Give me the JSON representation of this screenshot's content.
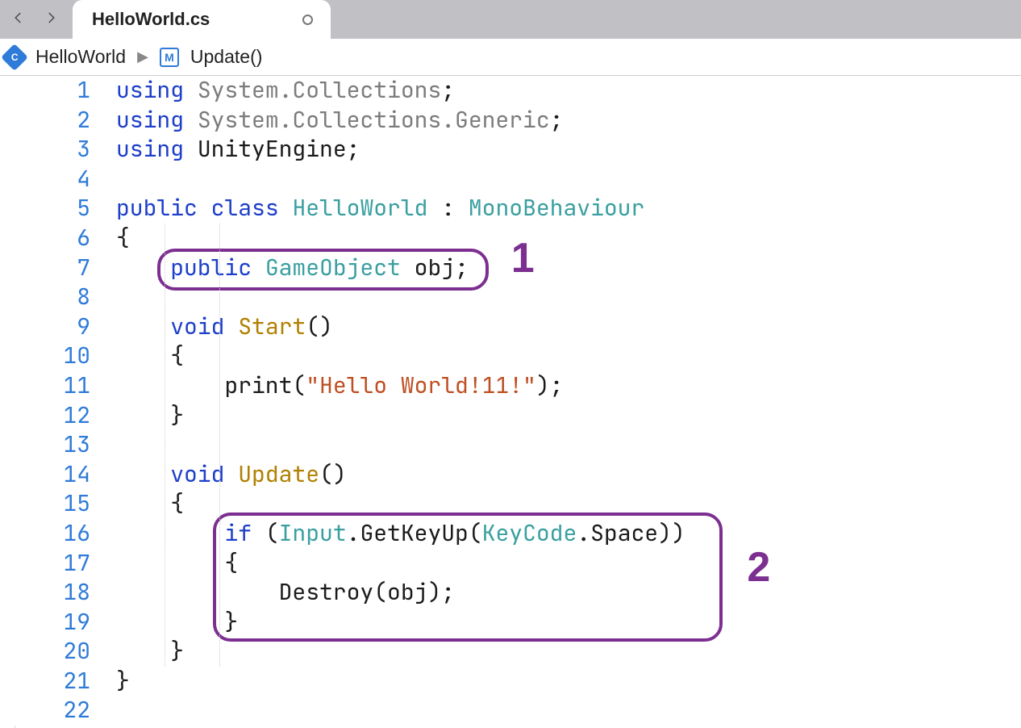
{
  "tab": {
    "title": "HelloWorld.cs"
  },
  "breadcrumb": {
    "class": "HelloWorld",
    "method": "Update()"
  },
  "colors": {
    "annotation": "#7c2f91",
    "keyword": "#1e3fc9",
    "type": "#3a9fa0",
    "string": "#bf4f22",
    "lineNumber": "#2f7bd9"
  },
  "annotations": [
    {
      "id": 1,
      "label": "1",
      "target_lines": [
        7
      ]
    },
    {
      "id": 2,
      "label": "2",
      "target_lines": [
        16,
        17,
        18,
        19
      ]
    }
  ],
  "code": [
    {
      "n": 1,
      "indent": 0,
      "tokens": [
        [
          "kw",
          "using"
        ],
        [
          "punct",
          " "
        ],
        [
          "ns",
          "System.Collections"
        ],
        [
          "punct",
          ";"
        ]
      ]
    },
    {
      "n": 2,
      "indent": 0,
      "tokens": [
        [
          "kw",
          "using"
        ],
        [
          "punct",
          " "
        ],
        [
          "ns",
          "System.Collections.Generic"
        ],
        [
          "punct",
          ";"
        ]
      ]
    },
    {
      "n": 3,
      "indent": 0,
      "tokens": [
        [
          "kw",
          "using"
        ],
        [
          "punct",
          " "
        ],
        [
          "ident",
          "UnityEngine"
        ],
        [
          "punct",
          ";"
        ]
      ]
    },
    {
      "n": 4,
      "indent": 0,
      "tokens": []
    },
    {
      "n": 5,
      "indent": 0,
      "tokens": [
        [
          "kw",
          "public"
        ],
        [
          "punct",
          " "
        ],
        [
          "kw",
          "class"
        ],
        [
          "punct",
          " "
        ],
        [
          "classname",
          "HelloWorld"
        ],
        [
          "punct",
          " : "
        ],
        [
          "type",
          "MonoBehaviour"
        ]
      ]
    },
    {
      "n": 6,
      "indent": 0,
      "tokens": [
        [
          "punct",
          "{"
        ]
      ]
    },
    {
      "n": 7,
      "indent": 1,
      "tokens": [
        [
          "kw",
          "public"
        ],
        [
          "punct",
          " "
        ],
        [
          "type",
          "GameObject"
        ],
        [
          "punct",
          " "
        ],
        [
          "ident",
          "obj"
        ],
        [
          "punct",
          ";"
        ]
      ]
    },
    {
      "n": 8,
      "indent": 1,
      "tokens": []
    },
    {
      "n": 9,
      "indent": 1,
      "tokens": [
        [
          "kw",
          "void"
        ],
        [
          "punct",
          " "
        ],
        [
          "method",
          "Start"
        ],
        [
          "punct",
          "()"
        ]
      ]
    },
    {
      "n": 10,
      "indent": 1,
      "tokens": [
        [
          "punct",
          "{"
        ]
      ]
    },
    {
      "n": 11,
      "indent": 2,
      "tokens": [
        [
          "ident",
          "print"
        ],
        [
          "punct",
          "("
        ],
        [
          "str",
          "\"Hello World!11!\""
        ],
        [
          "punct",
          ");"
        ]
      ]
    },
    {
      "n": 12,
      "indent": 1,
      "tokens": [
        [
          "punct",
          "}"
        ]
      ]
    },
    {
      "n": 13,
      "indent": 1,
      "tokens": []
    },
    {
      "n": 14,
      "indent": 1,
      "tokens": [
        [
          "kw",
          "void"
        ],
        [
          "punct",
          " "
        ],
        [
          "method",
          "Update"
        ],
        [
          "punct",
          "()"
        ]
      ]
    },
    {
      "n": 15,
      "indent": 1,
      "tokens": [
        [
          "punct",
          "{"
        ]
      ]
    },
    {
      "n": 16,
      "indent": 2,
      "tokens": [
        [
          "kw",
          "if"
        ],
        [
          "punct",
          " ("
        ],
        [
          "type",
          "Input"
        ],
        [
          "punct",
          "."
        ],
        [
          "ident",
          "GetKeyUp"
        ],
        [
          "punct",
          "("
        ],
        [
          "type",
          "KeyCode"
        ],
        [
          "punct",
          "."
        ],
        [
          "ident",
          "Space"
        ],
        [
          "punct",
          "))"
        ]
      ]
    },
    {
      "n": 17,
      "indent": 2,
      "tokens": [
        [
          "punct",
          "{"
        ]
      ]
    },
    {
      "n": 18,
      "indent": 3,
      "tokens": [
        [
          "ident",
          "Destroy"
        ],
        [
          "punct",
          "("
        ],
        [
          "ident",
          "obj"
        ],
        [
          "punct",
          ");"
        ]
      ]
    },
    {
      "n": 19,
      "indent": 2,
      "tokens": [
        [
          "punct",
          "}"
        ]
      ]
    },
    {
      "n": 20,
      "indent": 1,
      "tokens": [
        [
          "punct",
          "}"
        ]
      ]
    },
    {
      "n": 21,
      "indent": 0,
      "tokens": [
        [
          "punct",
          "}"
        ]
      ]
    },
    {
      "n": 22,
      "indent": 0,
      "tokens": []
    }
  ]
}
